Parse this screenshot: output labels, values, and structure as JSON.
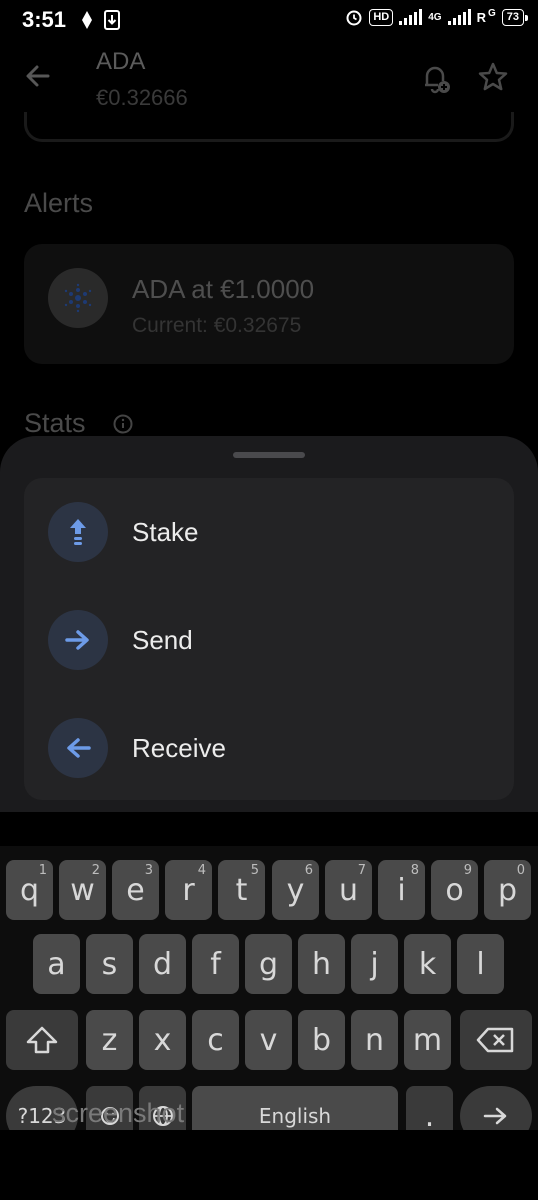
{
  "status_bar": {
    "time": "3:51",
    "hd": "HD",
    "network": "4G",
    "roaming": "R",
    "network2": "G",
    "battery": "73"
  },
  "header": {
    "title": "ADA",
    "price": "€0.32666"
  },
  "alerts": {
    "heading": "Alerts",
    "items": [
      {
        "title": "ADA at €1.0000",
        "current": "Current: €0.32675"
      }
    ]
  },
  "stats": {
    "heading": "Stats"
  },
  "actions": [
    {
      "label": "Stake",
      "icon": "stake-arrow-up-icon"
    },
    {
      "label": "Send",
      "icon": "arrow-right-icon"
    },
    {
      "label": "Receive",
      "icon": "arrow-left-icon"
    }
  ],
  "keyboard": {
    "row1": [
      {
        "k": "q",
        "h": "1"
      },
      {
        "k": "w",
        "h": "2"
      },
      {
        "k": "e",
        "h": "3"
      },
      {
        "k": "r",
        "h": "4"
      },
      {
        "k": "t",
        "h": "5"
      },
      {
        "k": "y",
        "h": "6"
      },
      {
        "k": "u",
        "h": "7"
      },
      {
        "k": "i",
        "h": "8"
      },
      {
        "k": "o",
        "h": "9"
      },
      {
        "k": "p",
        "h": "0"
      }
    ],
    "row2": [
      "a",
      "s",
      "d",
      "f",
      "g",
      "h",
      "j",
      "k",
      "l"
    ],
    "row3": [
      "z",
      "x",
      "c",
      "v",
      "b",
      "n",
      "m"
    ],
    "symbols_key": "?123",
    "space_label": "English",
    "period_key": "."
  },
  "watermark": "screenshot",
  "colors": {
    "sheet_bg": "#1b1b1d",
    "card_bg": "#232325",
    "icon_bg": "#2c3444",
    "icon_accent": "#6d9be8",
    "key_bg": "#4a4a4a"
  }
}
